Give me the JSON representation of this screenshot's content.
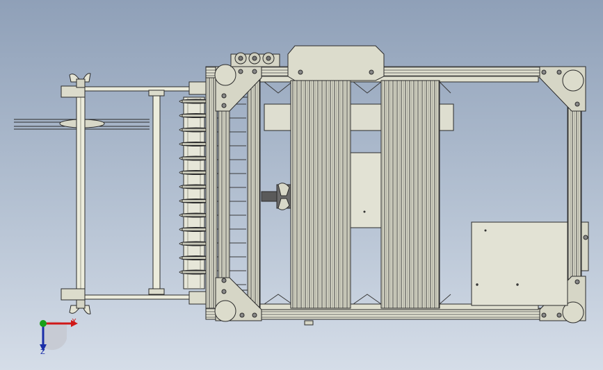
{
  "viewport": {
    "background_top": "#8fa0b8",
    "background_bottom": "#d5dde8"
  },
  "model": {
    "part_color": "#e8e8d8",
    "edge_color": "#2a2a2a",
    "shadow_color": "#b8b8a8"
  },
  "triad": {
    "x_label": "X",
    "z_label": "Z",
    "x_color": "#d01818",
    "y_color": "#18a018",
    "z_color": "#1a2ea8"
  }
}
